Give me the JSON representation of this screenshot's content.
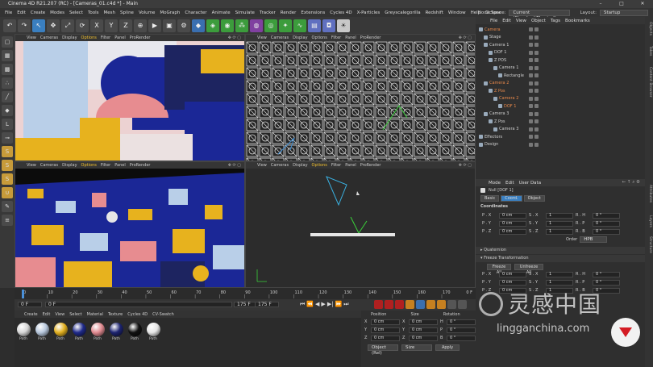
{
  "window": {
    "title": "Cinema 4D R21.207 (RC) - [Cameras_01.c4d *] - Main",
    "controls": [
      "–",
      "□",
      "✕"
    ]
  },
  "menubar": {
    "items": [
      "File",
      "Edit",
      "Create",
      "Modes",
      "Select",
      "Tools",
      "Mesh",
      "Spline",
      "Volume",
      "MoGraph",
      "Character",
      "Animate",
      "Simulate",
      "Tracker",
      "Render",
      "Extensions",
      "Cycles 4D",
      "X-Particles",
      "Greyscalegorilla",
      "Redshift",
      "Window",
      "Help",
      "Octane"
    ],
    "node_space_label": "Node Space:",
    "node_space_value": "Current (Standard/Physical)",
    "layout_label": "Layout:",
    "layout_value": "Startup"
  },
  "viewport_menu": [
    "View",
    "Cameras",
    "Display",
    "Options",
    "Filter",
    "Panel",
    "ProRender"
  ],
  "object_manager": {
    "menu": [
      "File",
      "Edit",
      "View",
      "Object",
      "Tags",
      "Bookmarks"
    ],
    "items": [
      {
        "name": "Camera",
        "depth": 0,
        "color": "#e8884a"
      },
      {
        "name": "Stage",
        "depth": 1,
        "color": "#cfcfcf"
      },
      {
        "name": "Camera 1",
        "depth": 1,
        "color": "#cfcfcf"
      },
      {
        "name": "DOF 1",
        "depth": 2,
        "color": "#cfcfcf"
      },
      {
        "name": "Z POS",
        "depth": 2,
        "color": "#cfcfcf"
      },
      {
        "name": "Camera 1",
        "depth": 3,
        "color": "#cfcfcf"
      },
      {
        "name": "Rectangle",
        "depth": 4,
        "color": "#cfcfcf"
      },
      {
        "name": "Camera 2",
        "depth": 1,
        "color": "#e8884a"
      },
      {
        "name": "Z Pos",
        "depth": 2,
        "color": "#e8884a"
      },
      {
        "name": "Camera 2",
        "depth": 3,
        "color": "#e8884a"
      },
      {
        "name": "DOF 1",
        "depth": 4,
        "color": "#e8884a"
      },
      {
        "name": "Camera 3",
        "depth": 1,
        "color": "#cfcfcf"
      },
      {
        "name": "Z Pos",
        "depth": 2,
        "color": "#cfcfcf"
      },
      {
        "name": "Camera 3",
        "depth": 3,
        "color": "#cfcfcf"
      },
      {
        "name": "Effectors",
        "depth": 0,
        "color": "#cfcfcf"
      },
      {
        "name": "Design",
        "depth": 0,
        "color": "#cfcfcf"
      }
    ],
    "side_tabs": [
      "Objects",
      "Takes",
      "Content Browser"
    ]
  },
  "attributes": {
    "menu": [
      "Mode",
      "Edit",
      "User Data"
    ],
    "object_name": "Null [DOF 1]",
    "tabs": [
      "Basic",
      "Coord.",
      "Object"
    ],
    "active_tab": "Coord.",
    "section": "Coordinates",
    "rows": [
      {
        "p": "P . X",
        "pv": "0 cm",
        "s": "S . X",
        "sv": "1",
        "r": "R . H",
        "rv": "0 °"
      },
      {
        "p": "P . Y",
        "pv": "0 cm",
        "s": "S . Y",
        "sv": "1",
        "r": "R . P",
        "rv": "0 °"
      },
      {
        "p": "P . Z",
        "pv": "0 cm",
        "s": "S . Z",
        "sv": "1",
        "r": "R . B",
        "rv": "0 °"
      }
    ],
    "order_label": "Order",
    "order_value": "HPB",
    "quaternion": "Quaternion",
    "freeze": "Freeze Transformation",
    "freeze_all": "Freeze All",
    "unfreeze_all": "Unfreeze All",
    "frozen_rows": [
      {
        "p": "P . X",
        "pv": "0 cm",
        "s": "S . X",
        "sv": "1",
        "r": "R . H",
        "rv": "0 °"
      },
      {
        "p": "P . Y",
        "pv": "0 cm",
        "s": "S . Y",
        "sv": "1",
        "r": "R . P",
        "rv": "0 °"
      },
      {
        "p": "P . Z",
        "pv": "0 cm",
        "s": "S . Z",
        "sv": "1",
        "r": "R . B",
        "rv": "0 °"
      }
    ],
    "side_tabs": [
      "Attributes",
      "Layers",
      "Structure"
    ]
  },
  "timeline": {
    "ticks": [
      "0",
      "10",
      "20",
      "30",
      "40",
      "50",
      "60",
      "70",
      "80",
      "90",
      "100",
      "110",
      "120",
      "130",
      "140",
      "150",
      "160",
      "170"
    ],
    "current_frame": "0 F",
    "start": "0 F",
    "field2": "0 F",
    "end": "175 F",
    "end2": "175 F"
  },
  "material_manager": {
    "menu": [
      "Create",
      "Edit",
      "View",
      "Select",
      "Material",
      "Texture",
      "Cycles 4D",
      "CV-Swatch"
    ],
    "materials": [
      {
        "label": "Path",
        "color": "#d6d6d6"
      },
      {
        "label": "Path",
        "color": "#b7c7dc"
      },
      {
        "label": "Path",
        "color": "#e2b020"
      },
      {
        "label": "Path",
        "color": "#1f2a8a"
      },
      {
        "label": "Path",
        "color": "#e08a90"
      },
      {
        "label": "Path",
        "color": "#1d2470"
      },
      {
        "label": "Path",
        "color": "#111111"
      },
      {
        "label": "Path",
        "color": "#e6e6e6"
      }
    ]
  },
  "coordinates": {
    "headers": [
      "Position",
      "Size",
      "Rotation"
    ],
    "rows": [
      {
        "a": "X",
        "av": "0 cm",
        "b": "X",
        "bv": "0 cm",
        "c": "H",
        "cv": "0 °"
      },
      {
        "a": "Y",
        "av": "0 cm",
        "b": "Y",
        "bv": "0 cm",
        "c": "P",
        "cv": "0 °"
      },
      {
        "a": "Z",
        "av": "0 cm",
        "b": "Z",
        "bv": "0 cm",
        "c": "B",
        "cv": "0 °"
      }
    ],
    "mode": "Object (Rel)",
    "size_mode": "Size",
    "apply": "Apply"
  },
  "watermark": {
    "chinese": "灵感中国",
    "url": "lingganchina.com"
  }
}
